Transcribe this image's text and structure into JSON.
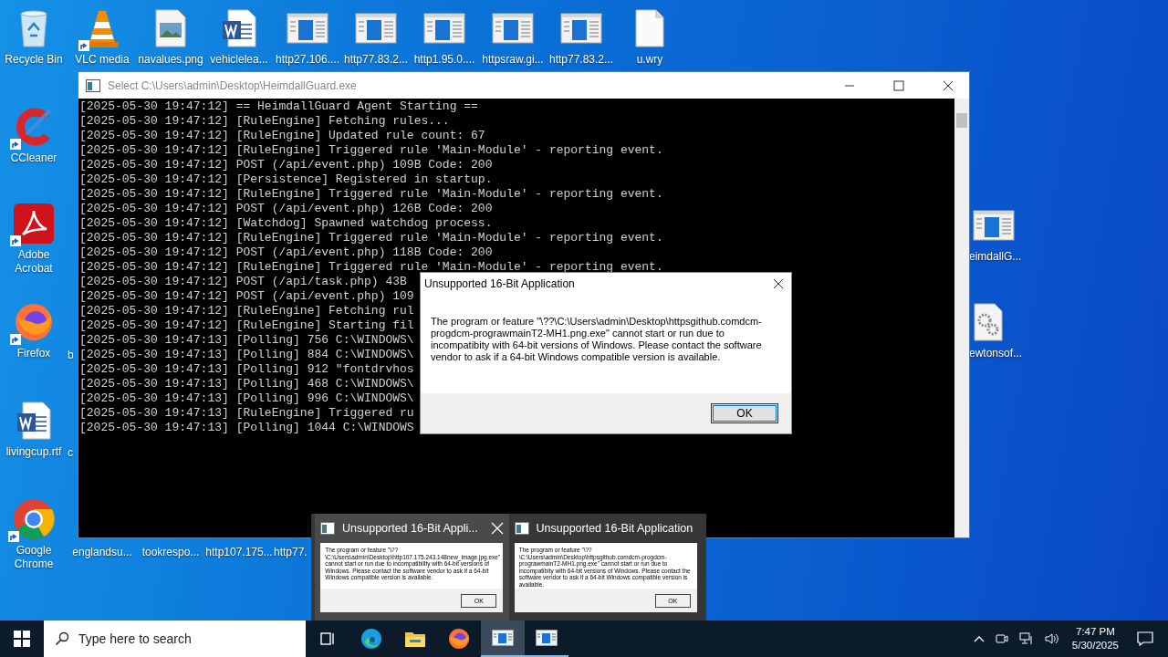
{
  "desktop_icons": [
    {
      "label": "Recycle Bin",
      "kind": "recycle",
      "shortcut": false
    },
    {
      "label": "VLC media",
      "kind": "vlc",
      "shortcut": true
    },
    {
      "label": "navalues.png",
      "kind": "image",
      "shortcut": false
    },
    {
      "label": "vehiclelea...",
      "kind": "word",
      "shortcut": false
    },
    {
      "label": "http27.106....",
      "kind": "app",
      "shortcut": false
    },
    {
      "label": "http77.83.2...",
      "kind": "app",
      "shortcut": false
    },
    {
      "label": "http1.95.0....",
      "kind": "app",
      "shortcut": false
    },
    {
      "label": "httpsraw.gi...",
      "kind": "app",
      "shortcut": false
    },
    {
      "label": "http77.83.2...",
      "kind": "app",
      "shortcut": false
    },
    {
      "label": "u.wry",
      "kind": "blank",
      "shortcut": false
    },
    {
      "label": "CCleaner",
      "kind": "ccleaner",
      "shortcut": true
    },
    {
      "label": "Adobe Acrobat",
      "kind": "acrobat",
      "shortcut": true
    },
    {
      "label": "Firefox",
      "kind": "firefox",
      "shortcut": true
    },
    {
      "label": "livingcup.rtf",
      "kind": "word",
      "shortcut": false
    },
    {
      "label": "Google Chrome",
      "kind": "chrome",
      "shortcut": true
    },
    {
      "label": "eimdallG...",
      "kind": "app",
      "shortcut": false
    },
    {
      "label": "ewtonsof...",
      "kind": "gear",
      "shortcut": false
    }
  ],
  "hidden_icon_labels": [
    "b",
    "c",
    "englandsu...",
    "tookrespo...",
    "http107.175...",
    "http77."
  ],
  "console": {
    "title": "Select C:\\Users\\admin\\Desktop\\HeimdallGuard.exe",
    "lines": [
      "[2025-05-30 19:47:12] == HeimdallGuard Agent Starting ==",
      "[2025-05-30 19:47:12] [RuleEngine] Fetching rules...",
      "[2025-05-30 19:47:12] [RuleEngine] Updated rule count: 67",
      "[2025-05-30 19:47:12] [RuleEngine] Triggered rule 'Main-Module' - reporting event.",
      "[2025-05-30 19:47:12] POST (/api/event.php) 109B Code: 200",
      "[2025-05-30 19:47:12] [Persistence] Registered in startup.",
      "[2025-05-30 19:47:12] [RuleEngine] Triggered rule 'Main-Module' - reporting event.",
      "[2025-05-30 19:47:12] POST (/api/event.php) 126B Code: 200",
      "[2025-05-30 19:47:12] [Watchdog] Spawned watchdog process.",
      "[2025-05-30 19:47:12] [RuleEngine] Triggered rule 'Main-Module' - reporting event.",
      "[2025-05-30 19:47:12] POST (/api/event.php) 118B Code: 200",
      "[2025-05-30 19:47:12] [RuleEngine] Triggered rule 'Main-Module' - reporting event.",
      "[2025-05-30 19:47:12] POST (/api/task.php) 43B",
      "[2025-05-30 19:47:12] POST (/api/event.php) 109",
      "[2025-05-30 19:47:12] [RuleEngine] Fetching rul",
      "[2025-05-30 19:47:12] [RuleEngine] Starting fil",
      "[2025-05-30 19:47:13] [Polling] 756 C:\\WINDOWS\\",
      "[2025-05-30 19:47:13] [Polling] 884 C:\\WINDOWS\\",
      "[2025-05-30 19:47:13] [Polling] 912 \"fontdrvhos",
      "[2025-05-30 19:47:13] [Polling] 468 C:\\WINDOWS\\",
      "[2025-05-30 19:47:13] [Polling] 996 C:\\WINDOWS\\",
      "[2025-05-30 19:47:13] [RuleEngine] Triggered ru",
      "[2025-05-30 19:47:13] [Polling] 1044 C:\\WINDOWS"
    ]
  },
  "dialog": {
    "title": "Unsupported 16-Bit Application",
    "message": "The program or feature \"\\??\\C:\\Users\\admin\\Desktop\\httpsgithub.comdcm-progdcm-prograwmainT2-MH1.png.exe\" cannot start or run due to incompatibity with 64-bit versions of Windows. Please contact the software vendor to ask if a 64-bit Windows compatible version is available.",
    "button": "OK"
  },
  "taskbar_previews": [
    {
      "title": "Unsupported 16-Bit Appli...",
      "closable": true,
      "message": "The program or feature \"\\??\\C:\\Users\\admin\\Desktop\\http107.175.243.148new_image.jpg.exe\" cannot start or run due to incompatibility with 64-bit versions of Windows. Please contact the software vendor to ask if a 64-bit Windows compatible version is available.",
      "button": "OK"
    },
    {
      "title": "Unsupported 16-Bit Application",
      "closable": false,
      "message": "The program or feature \"\\??\\C:\\Users\\admin\\Desktop\\httpsgithub.comdcm-progdcm-prograwmainT2-MH1.png.exe\" cannot start or run due to incompatibity with 64-bit versions of Windows. Please contact the software vendor to ask if a 64-bit Windows compatible version is available.",
      "button": "OK"
    }
  ],
  "taskbar": {
    "search": {
      "placeholder": "Type here to search"
    },
    "apps": [
      {
        "kind": "taskview",
        "selected": false
      },
      {
        "kind": "edge",
        "selected": false
      },
      {
        "kind": "explorer",
        "selected": false
      },
      {
        "kind": "firefox",
        "selected": false
      },
      {
        "kind": "console",
        "selected": true
      },
      {
        "kind": "console",
        "selected": false
      }
    ],
    "time": "7:47 PM",
    "date": "5/30/2025"
  }
}
